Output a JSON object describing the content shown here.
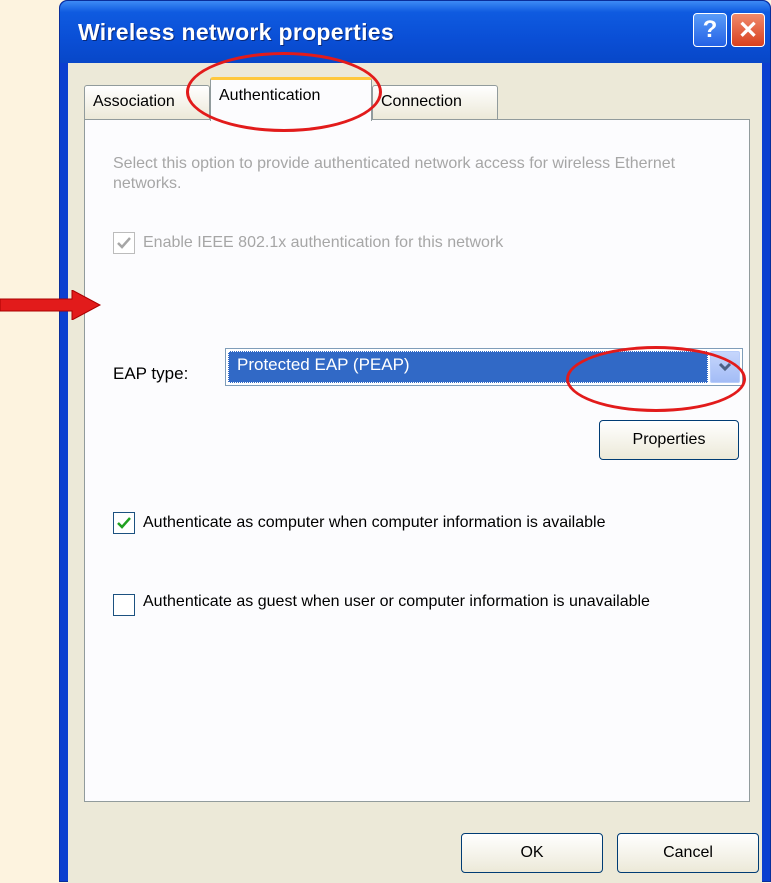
{
  "window": {
    "title": "Wireless network properties",
    "help_label": "?",
    "close_label": "✕"
  },
  "tabs": [
    {
      "label": "Association",
      "active": false
    },
    {
      "label": "Authentication",
      "active": true
    },
    {
      "label": "Connection",
      "active": false
    }
  ],
  "authentication": {
    "description": "Select this option to provide authenticated network access for wireless Ethernet networks.",
    "enable_ieee": {
      "label": "Enable IEEE 802.1x authentication for this network",
      "checked": true,
      "disabled": true
    },
    "eap_type_label": "EAP type:",
    "eap_type_value": "Protected EAP (PEAP)",
    "properties_button": "Properties",
    "auth_computer": {
      "label": "Authenticate as computer when computer information is available",
      "checked": true
    },
    "auth_guest": {
      "label": "Authenticate as guest when user or computer information is unavailable",
      "checked": false
    }
  },
  "footer": {
    "ok_label": "OK",
    "cancel_label": "Cancel"
  },
  "annotations": {
    "color": "#e21b1b",
    "arrow_target": "EAP type",
    "circled": [
      "Authentication tab",
      "Properties button"
    ]
  },
  "colors": {
    "title_bar": "#0a4fd6",
    "selection": "#3169c6",
    "background": "#fdf3df"
  }
}
